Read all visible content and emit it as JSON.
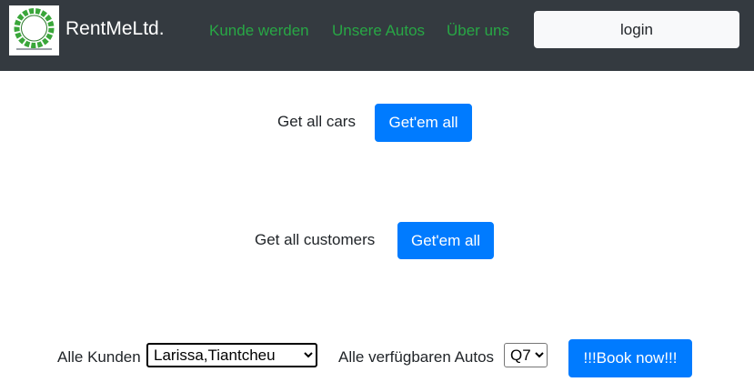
{
  "navbar": {
    "brand": "RentMeLtd.",
    "links": [
      "Kunde werden",
      "Unsere Autos",
      "Über uns"
    ],
    "login_label": "login",
    "colors": {
      "background": "#343a40",
      "link": "#28a745"
    }
  },
  "cars_section": {
    "label": "Get all cars",
    "button_label": "Get'em all"
  },
  "customers_section": {
    "label": "Get all customers",
    "button_label": "Get'em all"
  },
  "booking": {
    "customers_label": "Alle Kunden",
    "customers_selected": "Larissa,Tiantcheu",
    "cars_label": "Alle verfügbaren Autos",
    "cars_selected": "Q7",
    "book_button_label": "!!!Book now!!!"
  },
  "colors": {
    "primary": "#007bff"
  }
}
